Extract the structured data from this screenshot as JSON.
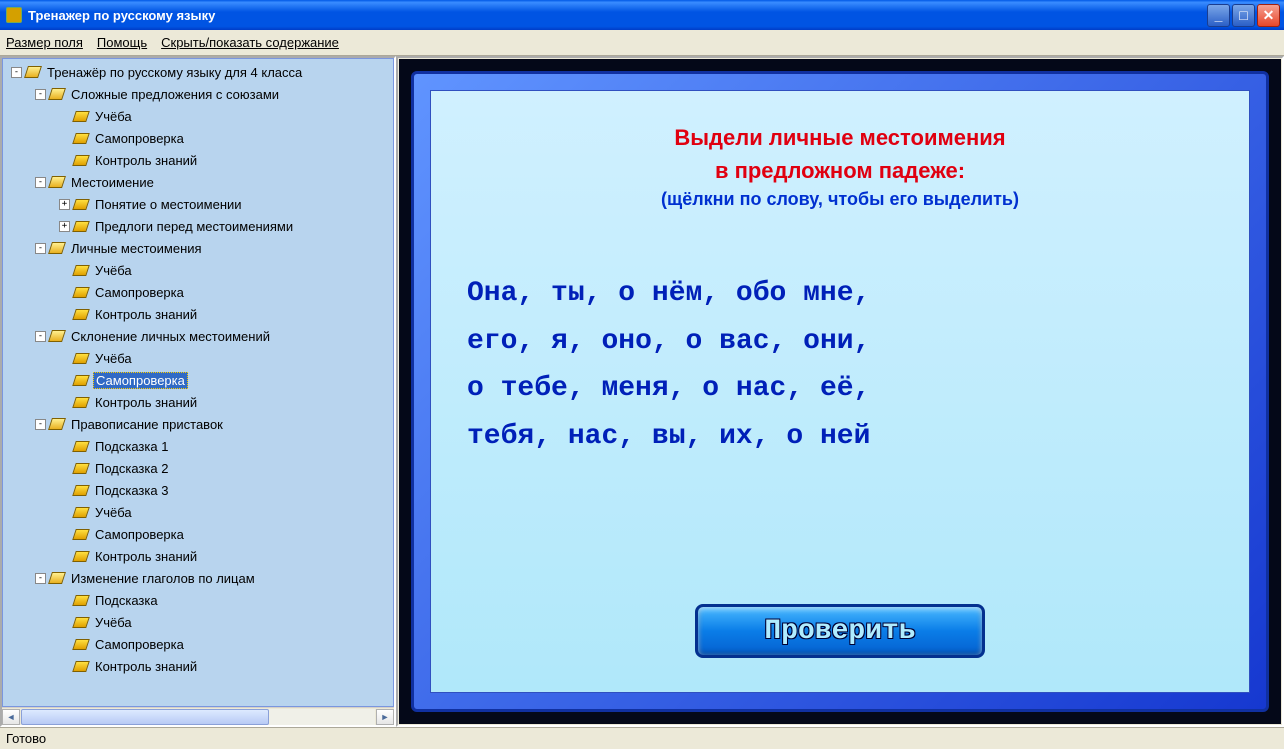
{
  "window": {
    "title": "Тренажер по русскому языку"
  },
  "menu": {
    "field_size": "Размер поля",
    "help": "Помощь",
    "toggle_toc": "Скрыть/показать содержание"
  },
  "tree": [
    {
      "depth": 0,
      "exp": "-",
      "icon": "open",
      "label": "Тренажёр по русскому языку для 4 класса"
    },
    {
      "depth": 1,
      "exp": "-",
      "icon": "open",
      "label": "Сложные предложения с союзами"
    },
    {
      "depth": 2,
      "exp": "",
      "icon": "leaf",
      "label": "Учёба"
    },
    {
      "depth": 2,
      "exp": "",
      "icon": "leaf",
      "label": "Самопроверка"
    },
    {
      "depth": 2,
      "exp": "",
      "icon": "leaf",
      "label": "Контроль знаний"
    },
    {
      "depth": 1,
      "exp": "-",
      "icon": "open",
      "label": "Местоимение"
    },
    {
      "depth": 2,
      "exp": "+",
      "icon": "leaf",
      "label": "Понятие о местоимении"
    },
    {
      "depth": 2,
      "exp": "+",
      "icon": "leaf",
      "label": "Предлоги перед местоимениями"
    },
    {
      "depth": 1,
      "exp": "-",
      "icon": "open",
      "label": "Личные местоимения"
    },
    {
      "depth": 2,
      "exp": "",
      "icon": "leaf",
      "label": "Учёба"
    },
    {
      "depth": 2,
      "exp": "",
      "icon": "leaf",
      "label": "Самопроверка"
    },
    {
      "depth": 2,
      "exp": "",
      "icon": "leaf",
      "label": "Контроль знаний"
    },
    {
      "depth": 1,
      "exp": "-",
      "icon": "open",
      "label": "Склонение личных местоимений"
    },
    {
      "depth": 2,
      "exp": "",
      "icon": "leaf",
      "label": "Учёба"
    },
    {
      "depth": 2,
      "exp": "",
      "icon": "leaf",
      "label": "Самопроверка",
      "selected": true
    },
    {
      "depth": 2,
      "exp": "",
      "icon": "leaf",
      "label": "Контроль знаний"
    },
    {
      "depth": 1,
      "exp": "-",
      "icon": "open",
      "label": "Правописание приставок"
    },
    {
      "depth": 2,
      "exp": "",
      "icon": "leaf",
      "label": "Подсказка 1"
    },
    {
      "depth": 2,
      "exp": "",
      "icon": "leaf",
      "label": "Подсказка 2"
    },
    {
      "depth": 2,
      "exp": "",
      "icon": "leaf",
      "label": "Подсказка 3"
    },
    {
      "depth": 2,
      "exp": "",
      "icon": "leaf",
      "label": "Учёба"
    },
    {
      "depth": 2,
      "exp": "",
      "icon": "leaf",
      "label": "Самопроверка"
    },
    {
      "depth": 2,
      "exp": "",
      "icon": "leaf",
      "label": "Контроль знаний"
    },
    {
      "depth": 1,
      "exp": "-",
      "icon": "open",
      "label": "Изменение глаголов по лицам"
    },
    {
      "depth": 2,
      "exp": "",
      "icon": "leaf",
      "label": "Подсказка"
    },
    {
      "depth": 2,
      "exp": "",
      "icon": "leaf",
      "label": "Учёба"
    },
    {
      "depth": 2,
      "exp": "",
      "icon": "leaf",
      "label": "Самопроверка"
    },
    {
      "depth": 2,
      "exp": "",
      "icon": "leaf",
      "label": "Контроль знаний"
    }
  ],
  "exercise": {
    "title_line1": "Выдели личные местоимения",
    "title_line2": "в предложном падеже:",
    "hint": "(щёлкни по слову, чтобы его выделить)",
    "lines": [
      [
        "Она",
        ",",
        " ",
        "ты",
        ",",
        " ",
        "о нём",
        ",",
        " ",
        "обо мне",
        ","
      ],
      [
        "его",
        ",",
        " ",
        "я",
        ",",
        " ",
        "оно",
        ",",
        " ",
        "о вас",
        ",",
        " ",
        "они",
        ","
      ],
      [
        "о тебе",
        ",",
        " ",
        "меня",
        ",",
        " ",
        "о нас",
        ",",
        " ",
        "её",
        ","
      ],
      [
        "тебя",
        ",",
        " ",
        "нас",
        ",",
        " ",
        "вы",
        ",",
        " ",
        "их",
        ",",
        " ",
        "о ней"
      ]
    ],
    "check_button": "Проверить"
  },
  "status": "Готово"
}
